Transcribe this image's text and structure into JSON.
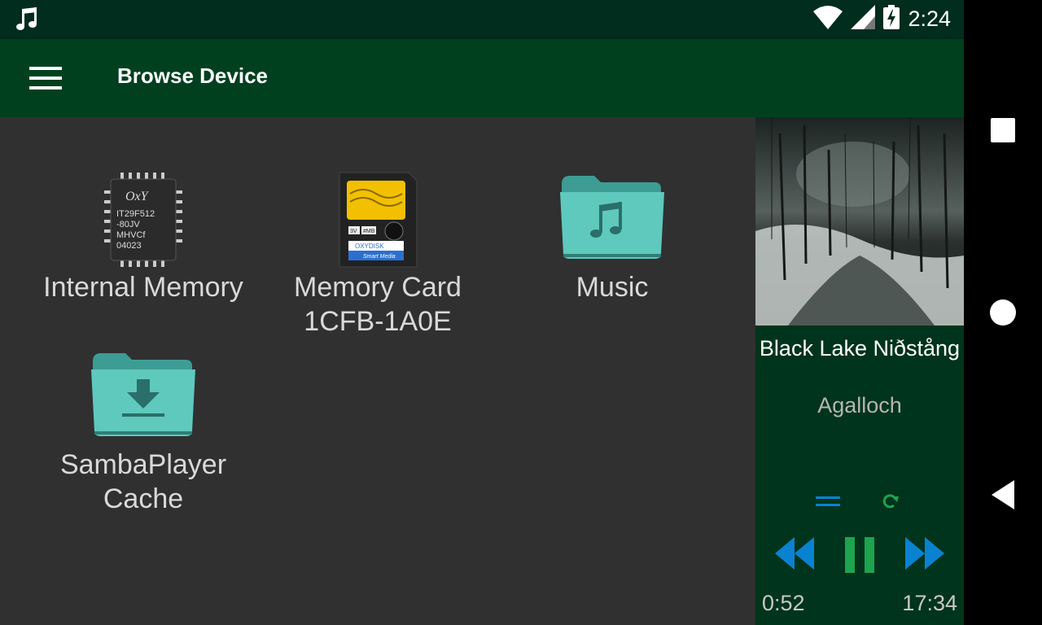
{
  "status_bar": {
    "left_icon": "music-note-icon",
    "icons": [
      "wifi-icon",
      "cell-signal-icon",
      "battery-charging-icon"
    ],
    "time": "2:24"
  },
  "app_bar": {
    "menu_icon": "hamburger-menu-icon",
    "title": "Browse Device"
  },
  "browser": {
    "items": [
      {
        "label_line1": "Internal Memory",
        "label_line2": "",
        "icon": "memory-chip-icon",
        "chip_text": [
          "IT29F512",
          "-80JV",
          "MHVCf",
          "04023"
        ],
        "chip_brand": "OxY"
      },
      {
        "label_line1": "Memory Card",
        "label_line2": "1CFB-1A0E",
        "icon": "smart-media-card-icon",
        "card_text": [
          "3V",
          "#MB",
          "OXYDISK",
          "Smart Media"
        ]
      },
      {
        "label_line1": "Music",
        "label_line2": "",
        "icon": "music-folder-icon"
      },
      {
        "label_line1": "SambaPlayer",
        "label_line2": "Cache",
        "icon": "download-folder-icon"
      }
    ]
  },
  "player": {
    "album_art": "album-art-snowy-forest",
    "title": "Black Lake Niðstång",
    "artist": "Agalloch",
    "controls": {
      "playlist_icon": "playlist-icon",
      "repeat_icon": "repeat-icon",
      "previous_icon": "rewind-icon",
      "pause_icon": "pause-icon",
      "next_icon": "fast-forward-icon"
    },
    "elapsed": "0:52",
    "duration": "17:34"
  },
  "nav_bar": {
    "recents_icon": "square-recents-icon",
    "home_icon": "circle-home-icon",
    "back_icon": "triangle-back-icon"
  },
  "colors": {
    "status_bar": "#002d1d",
    "app_bar": "#00401f",
    "content_bg": "#303030",
    "player_bg": "#00341c",
    "folder": "#5fc9bd",
    "control_blue": "#0a82d2",
    "control_green": "#1ea34e"
  }
}
